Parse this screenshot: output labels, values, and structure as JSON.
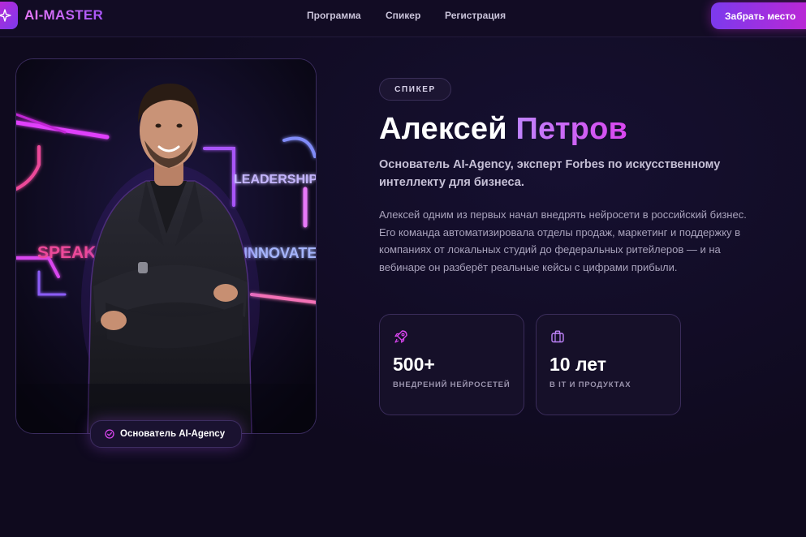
{
  "header": {
    "logo_text": "AI-MASTER",
    "nav": [
      {
        "label": "Программа"
      },
      {
        "label": "Спикер"
      },
      {
        "label": "Регистрация"
      }
    ],
    "cta_label": "Забрать место"
  },
  "photo": {
    "badge_label": "Основатель AI-Agency",
    "neon_signs": [
      "LEADERSHIP",
      "SPEAK",
      "INNOVATE"
    ]
  },
  "speaker": {
    "tag": "СПИКЕР",
    "first_name": "Алексей",
    "last_name": "Петров",
    "subtitle": "Основатель AI-Agency, эксперт Forbes по искусственному интеллекту для бизнеса.",
    "bio": "Алексей одним из первых начал внедрять нейросети в российский бизнес. Его команда автоматизировала отделы продаж, маркетинг и поддержку в компаниях от локальных студий до федеральных ритейлеров — и на вебинаре он разберёт реальные кейсы с цифрами прибыли."
  },
  "stats": [
    {
      "icon": "rocket-icon",
      "value": "500+",
      "caption": "ВНЕДРЕНИЙ НЕЙРОСЕТЕЙ"
    },
    {
      "icon": "briefcase-icon",
      "value": "10 лет",
      "caption": "В IT И ПРОДУКТАХ"
    }
  ],
  "colors": {
    "background": "#0f0a1e",
    "accent_purple": "#a855f7",
    "accent_magenta": "#d946ef"
  }
}
